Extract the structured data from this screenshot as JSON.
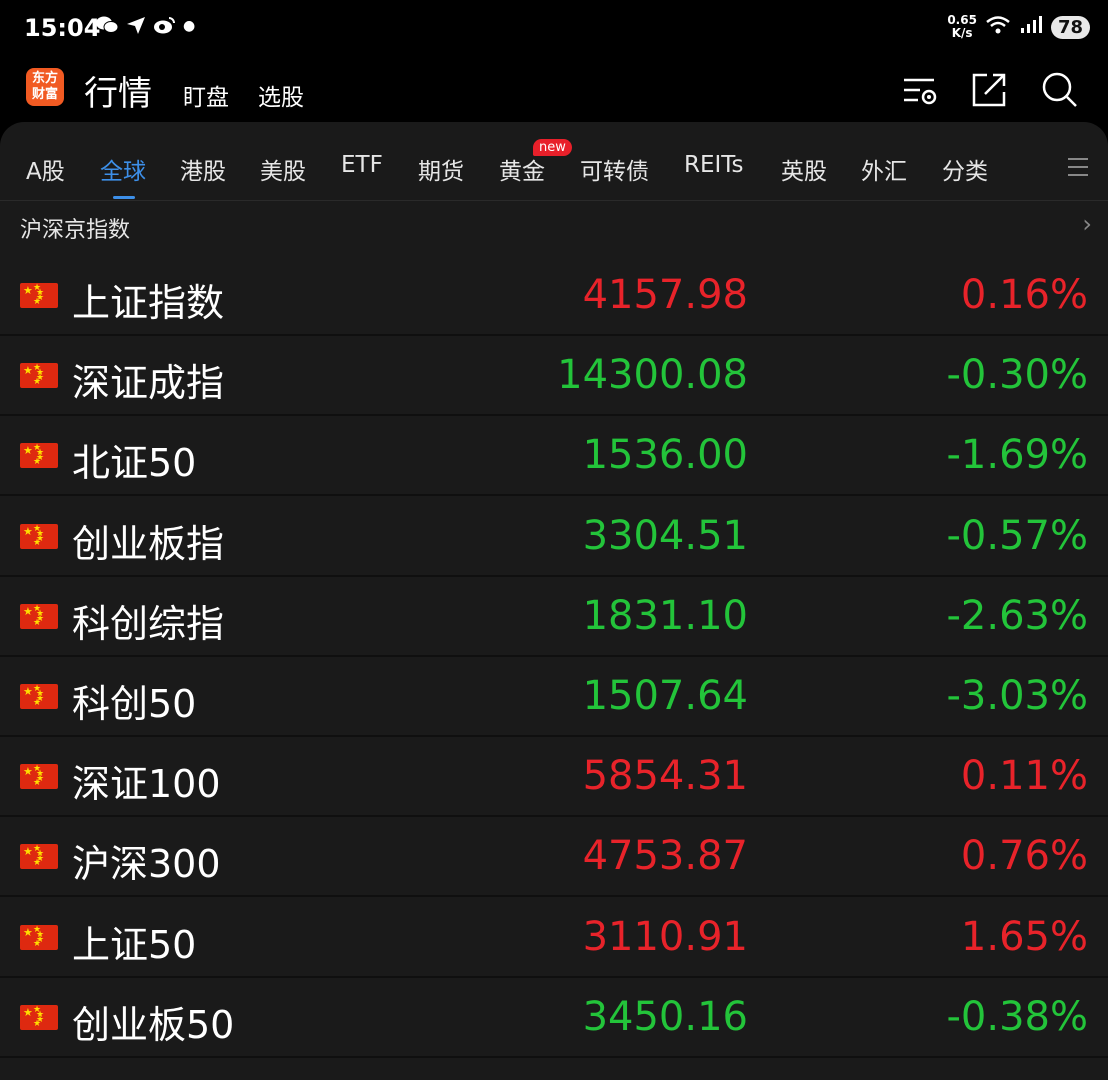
{
  "status": {
    "time": "15:04",
    "net_speed_value": "0.65",
    "net_speed_unit": "K/s",
    "battery": "78"
  },
  "header": {
    "logo_line1": "东方",
    "logo_line2": "财富",
    "title": "行情",
    "link1": "盯盘",
    "link2": "选股"
  },
  "tabs": [
    {
      "label": "A股",
      "active": false
    },
    {
      "label": "全球",
      "active": true
    },
    {
      "label": "港股",
      "active": false
    },
    {
      "label": "美股",
      "active": false
    },
    {
      "label": "ETF",
      "active": false
    },
    {
      "label": "期货",
      "active": false
    },
    {
      "label": "黄金",
      "active": false,
      "badge": "new"
    },
    {
      "label": "可转债",
      "active": false
    },
    {
      "label": "REITs",
      "active": false
    },
    {
      "label": "英股",
      "active": false
    },
    {
      "label": "外汇",
      "active": false
    },
    {
      "label": "分类",
      "active": false
    }
  ],
  "section": {
    "title": "沪深京指数"
  },
  "colors": {
    "up": "#e8232a",
    "down": "#23c43a",
    "accent": "#3d8fe8"
  },
  "indices": [
    {
      "name": "上证指数",
      "price": "4157.98",
      "change": "0.16%",
      "direction": "up"
    },
    {
      "name": "深证成指",
      "price": "14300.08",
      "change": "-0.30%",
      "direction": "down"
    },
    {
      "name": "北证50",
      "price": "1536.00",
      "change": "-1.69%",
      "direction": "down"
    },
    {
      "name": "创业板指",
      "price": "3304.51",
      "change": "-0.57%",
      "direction": "down"
    },
    {
      "name": "科创综指",
      "price": "1831.10",
      "change": "-2.63%",
      "direction": "down"
    },
    {
      "name": "科创50",
      "price": "1507.64",
      "change": "-3.03%",
      "direction": "down"
    },
    {
      "name": "深证100",
      "price": "5854.31",
      "change": "0.11%",
      "direction": "up"
    },
    {
      "name": "沪深300",
      "price": "4753.87",
      "change": "0.76%",
      "direction": "up"
    },
    {
      "name": "上证50",
      "price": "3110.91",
      "change": "1.65%",
      "direction": "up"
    },
    {
      "name": "创业板50",
      "price": "3450.16",
      "change": "-0.38%",
      "direction": "down"
    }
  ]
}
